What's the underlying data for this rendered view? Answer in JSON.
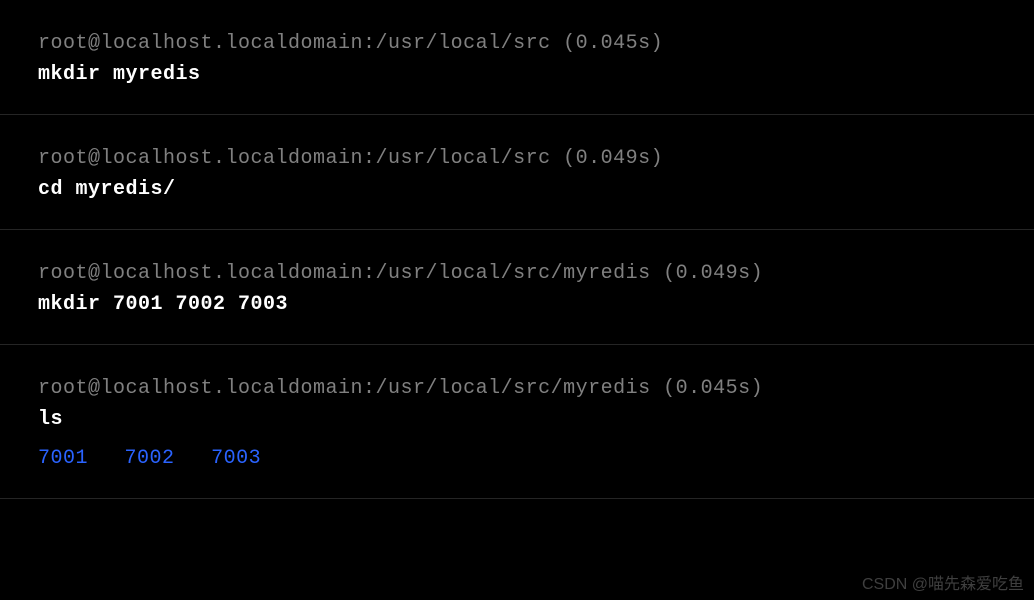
{
  "blocks": [
    {
      "prompt": "root@localhost.localdomain:/usr/local/src (0.045s)",
      "command": "mkdir myredis",
      "output": []
    },
    {
      "prompt": "root@localhost.localdomain:/usr/local/src (0.049s)",
      "command": "cd myredis/",
      "output": []
    },
    {
      "prompt": "root@localhost.localdomain:/usr/local/src/myredis (0.049s)",
      "command": "mkdir 7001 7002 7003",
      "output": []
    },
    {
      "prompt": "root@localhost.localdomain:/usr/local/src/myredis (0.045s)",
      "command": "ls",
      "output": [
        "7001",
        "7002",
        "7003"
      ]
    }
  ],
  "watermark": "CSDN @喵先森爱吃鱼"
}
